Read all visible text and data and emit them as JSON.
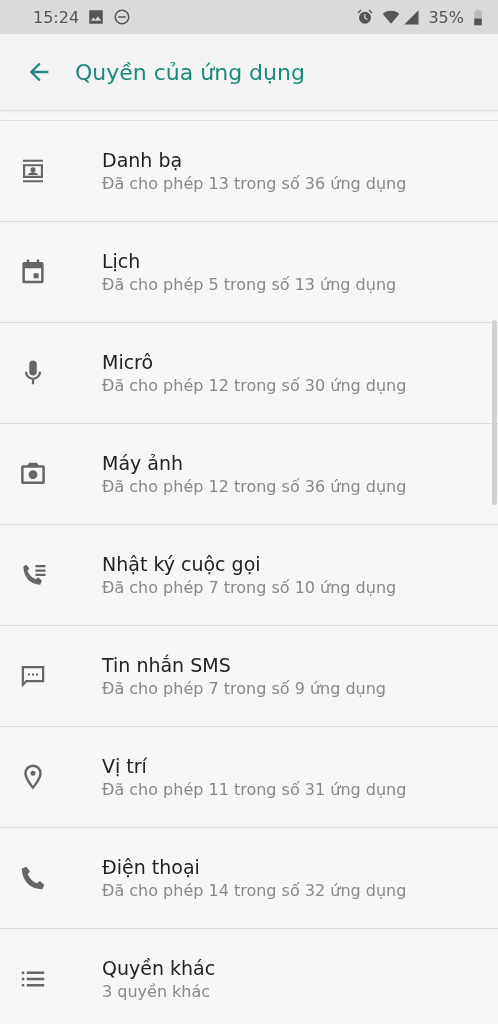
{
  "status_bar": {
    "time": "15:24",
    "battery": "35%"
  },
  "app_bar": {
    "title": "Quyền của ứng dụng"
  },
  "permissions": [
    {
      "kind": "contacts",
      "name": "Danh bạ",
      "summary": "Đã cho phép 13 trong số 36 ứng dụng"
    },
    {
      "kind": "calendar",
      "name": "Lịch",
      "summary": "Đã cho phép 5 trong số 13 ứng dụng"
    },
    {
      "kind": "microphone",
      "name": "Micrô",
      "summary": "Đã cho phép 12 trong số 30 ứng dụng"
    },
    {
      "kind": "camera",
      "name": "Máy ảnh",
      "summary": "Đã cho phép 12 trong số 36 ứng dụng"
    },
    {
      "kind": "call_log",
      "name": "Nhật ký cuộc gọi",
      "summary": "Đã cho phép 7 trong số 10 ứng dụng"
    },
    {
      "kind": "sms",
      "name": "Tin nhắn SMS",
      "summary": "Đã cho phép 7 trong số 9 ứng dụng"
    },
    {
      "kind": "location",
      "name": "Vị trí",
      "summary": "Đã cho phép 11 trong số 31 ứng dụng"
    },
    {
      "kind": "phone",
      "name": "Điện thoại",
      "summary": "Đã cho phép 14 trong số 32 ứng dụng"
    },
    {
      "kind": "more",
      "name": "Quyền khác",
      "summary": "3 quyền khác"
    }
  ]
}
